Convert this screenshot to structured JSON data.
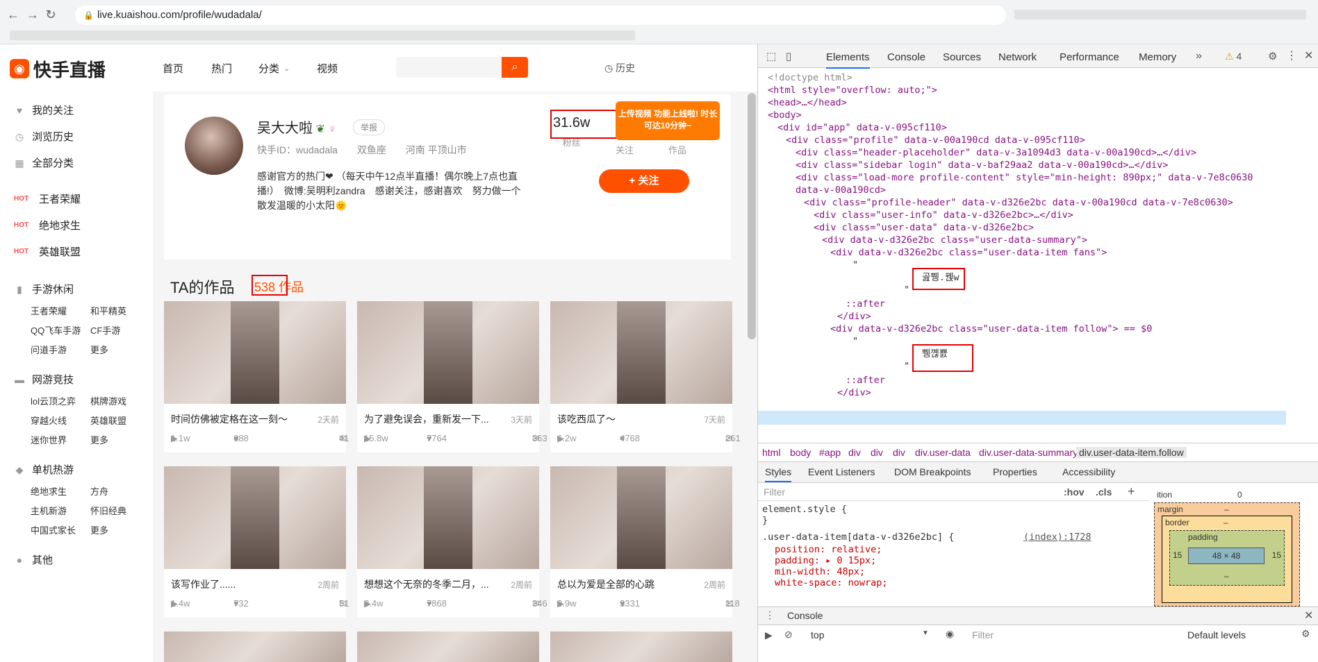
{
  "browser": {
    "url": "live.kuaishou.com/profile/wudadala/"
  },
  "site": {
    "logo_text": "快手直播",
    "nav": [
      "首页",
      "热门",
      "分类",
      "视频"
    ],
    "history": "历史",
    "promo": "上传视频 功能上线啦! 时长可达10分钟~"
  },
  "sidebar": {
    "top_items": [
      "我的关注",
      "浏览历史",
      "全部分类"
    ],
    "hot_label": "HOT",
    "hot_items": [
      "王者荣耀",
      "绝地求生",
      "英雄联盟"
    ],
    "groups": [
      {
        "title": "手游休闲",
        "items": [
          "王者荣耀",
          "和平精英",
          "QQ飞车手游",
          "CF手游",
          "问道手游",
          "更多"
        ]
      },
      {
        "title": "网游竞技",
        "items": [
          "lol云顶之弈",
          "棋牌游戏",
          "穿越火线",
          "英雄联盟",
          "迷你世界",
          "更多"
        ]
      },
      {
        "title": "单机热游",
        "items": [
          "绝地求生",
          "方舟",
          "主机新游",
          "怀旧经典",
          "中国式家长",
          "更多"
        ]
      }
    ],
    "other": "其他"
  },
  "profile": {
    "name": "吴大大啦",
    "report": "举报",
    "id_label": "快手ID：wudadala",
    "zodiac": "双鱼座",
    "location": "河南 平顶山市",
    "bio": "感谢官方的热门❤ （每天中午12点半直播！偶尔晚上7点也直播!）　微博:吴明利zandra　感谢关注，感谢喜欢　努力做一个散发温暖的小太阳🌞",
    "fans_num": "31.6w",
    "fans_label": "粉丝",
    "follow_label": "关注",
    "works_label": "作品",
    "follow_button": "+ 关注"
  },
  "works": {
    "heading": "TA的作品",
    "count": "538",
    "count_suffix": "作品",
    "cards": [
      {
        "title": "时间仿佛被定格在这一刻～",
        "date": "2天前",
        "plays": "1.1w",
        "likes": "688",
        "comments": "41"
      },
      {
        "title": "为了避免误会，重新发一下...",
        "date": "3天前",
        "plays": "15.8w",
        "likes": "7764",
        "comments": "363"
      },
      {
        "title": "该吃西瓜了～",
        "date": "7天前",
        "plays": "6.2w",
        "likes": "4768",
        "comments": "261"
      },
      {
        "title": "该写作业了......",
        "date": "2周前",
        "plays": "1.4w",
        "likes": "732",
        "comments": "51"
      },
      {
        "title": "想想这个无奈的冬季二月，...",
        "date": "2周前",
        "plays": "8.4w",
        "likes": "7868",
        "comments": "346"
      },
      {
        "title": "总以为爱是全部的心跳",
        "date": "2周前",
        "plays": "3.9w",
        "likes": "3331",
        "comments": "118"
      }
    ]
  },
  "devtools": {
    "tabs": [
      "Elements",
      "Console",
      "Sources",
      "Network",
      "Performance",
      "Memory"
    ],
    "warnings": "4",
    "dom_lines": [
      "<!doctype html>",
      "<html style=\"overflow: auto;\">",
      "<head>…</head>",
      "<body>",
      "<div id=\"app\" data-v-095cf110>",
      "<div class=\"profile\" data-v-00a190cd data-v-095cf110>",
      "<div class=\"header-placeholder\" data-v-3a1094d3 data-v-00a190cd>…</div>",
      "<div class=\"sidebar login\" data-v-baf29aa2 data-v-00a190cd>…</div>",
      "<div class=\"load-more profile-content\" style=\"min-height: 890px;\" data-v-7e8c0630",
      "data-v-00a190cd>",
      "<div class=\"profile-header\" data-v-d326e2bc data-v-00a190cd data-v-7e8c0630>",
      "<div class=\"user-info\" data-v-d326e2bc>…</div>",
      "<div class=\"user-data\" data-v-d326e2bc>",
      "<div data-v-d326e2bc class=\"user-data-summary\">",
      "<div data-v-d326e2bc class=\"user-data-item fans\">",
      "\"",
      "곮쀙.꿵w",
      "\"",
      "::after",
      "</div>",
      "<div data-v-d326e2bc class=\"user-data-item follow\"> == $0",
      "\"",
      "쀙꼖뾼",
      "\"",
      "::after",
      "</div>"
    ],
    "crumbs": [
      "html",
      "body",
      "#app",
      "div",
      "div",
      "div",
      "div.user-data",
      "div.user-data-summary",
      "div.user-data-item.follow"
    ],
    "subtabs": [
      "Styles",
      "Event Listeners",
      "DOM Breakpoints",
      "Properties",
      "Accessibility"
    ],
    "filter_placeholder": "Filter",
    "hov": ":hov",
    "cls": ".cls",
    "style_lines": [
      "element.style {",
      "}",
      ".user-data-item[data-v-d326e2bc] {",
      "position: relative;",
      "padding: ▸ 0 15px;",
      "min-width: 48px;",
      "white-space: nowrap;"
    ],
    "style_source": "(index):1728",
    "box": {
      "position_label": "ition",
      "position_value": "0",
      "margin": "margin",
      "border": "border",
      "padding": "padding",
      "content": "48 × 48",
      "side": "15",
      "dash": "–"
    },
    "console_tab": "Console",
    "console_context": "top",
    "console_filter": "Filter",
    "levels": "Default levels"
  }
}
